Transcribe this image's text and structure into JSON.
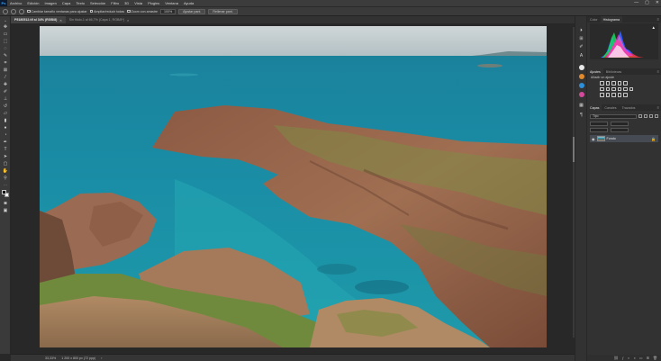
{
  "menubar": {
    "app_icon": "Ps",
    "items": [
      "Archivo",
      "Edición",
      "Imagen",
      "Capa",
      "Texto",
      "Selección",
      "Filtro",
      "3D",
      "Vista",
      "Plugins",
      "Ventana",
      "Ayuda"
    ],
    "window_controls": [
      "—",
      "▢",
      "✕"
    ]
  },
  "options": {
    "check1": "Cambiar tamaño ventanas para ajustar",
    "check2": "Ampliar/reducir todas",
    "check3": "Zoom con arrastre",
    "zoom_value": "100%",
    "fit_button": "Ajustar pant.",
    "fill_button": "Rellenar pant."
  },
  "tabs": [
    {
      "label": "P5180512.tif al 34% (RGB/8)",
      "active": true
    },
    {
      "label": "Sin título-1 al 66,7% (Capa 1, RGB/8*)",
      "active": false
    }
  ],
  "status": {
    "zoom": "33,33%",
    "info": "1 200 x 800 px (72 ppp)"
  },
  "panels": {
    "color_tab": "Color",
    "histogram_tab": "Histograma",
    "adjustments_tab": "Ajustes",
    "libraries_tab": "Bibliotecas",
    "adjust_hint": "Añadir un ajuste",
    "layers_tab": "Capas",
    "channels_tab": "Canales",
    "paths_tab": "Trazados",
    "kind_label": "Tipo",
    "layer_name": "Fondo"
  },
  "colors": {
    "accent_ps": "#31a8ff",
    "sea": "#1d8aa0",
    "rock": "#9b6a4e"
  }
}
